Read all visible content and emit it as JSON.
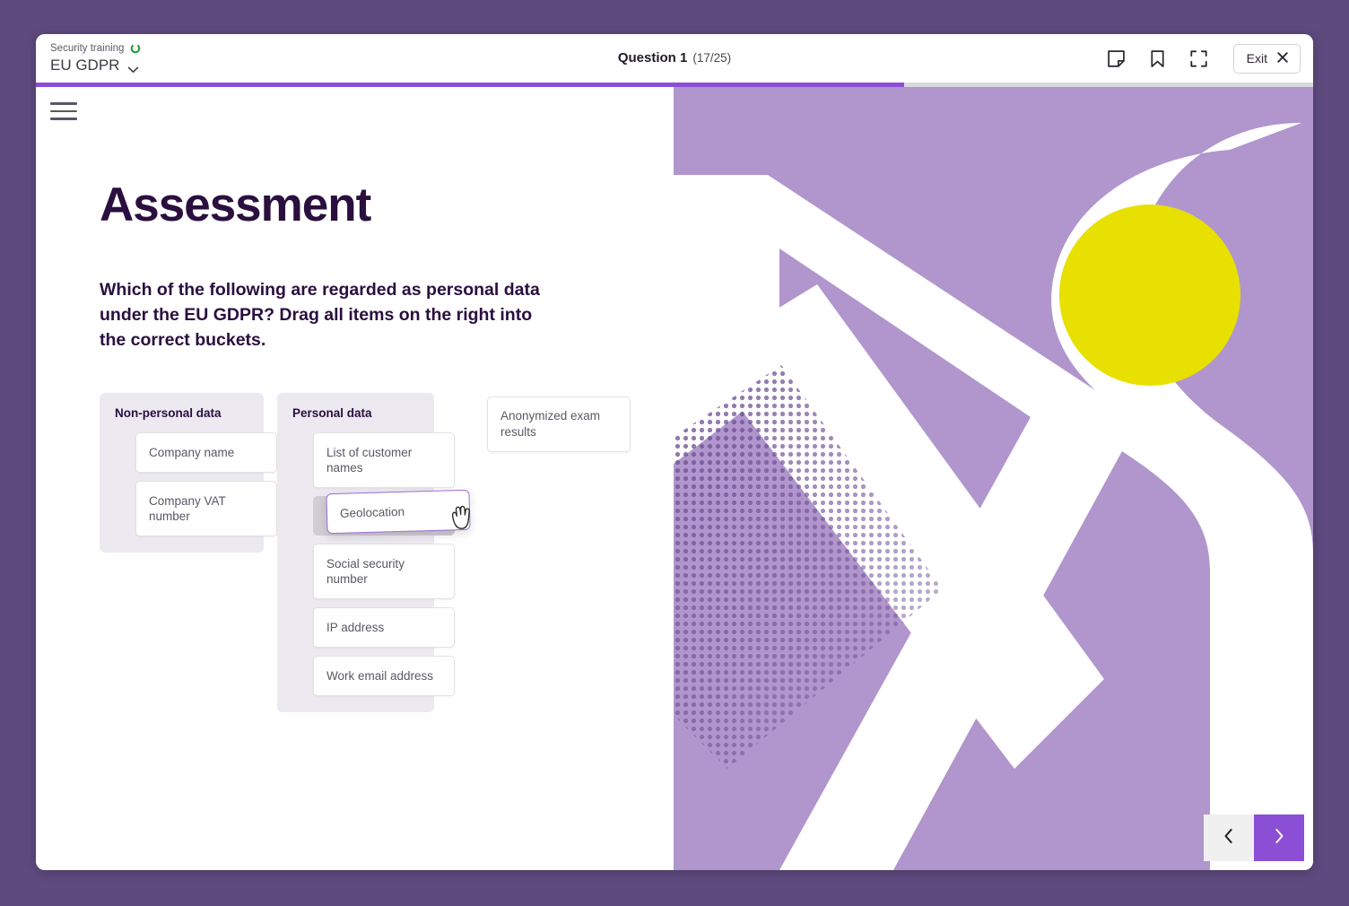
{
  "window": {
    "frame_color": "#5e4a7e",
    "accent_color": "#8b4fd6",
    "lavender": "#b096cc",
    "yellow": "#e8e000"
  },
  "header": {
    "course_label": "Security training",
    "course_name": "EU GDPR",
    "progress_icon": "progress-ring-icon",
    "chevron_icon": "chevron-down-icon",
    "question_title": "Question 1",
    "question_count": "(17/25)",
    "progress_percent": 68,
    "icons": [
      {
        "name": "note-icon",
        "label": "Notes"
      },
      {
        "name": "bookmark-icon",
        "label": "Bookmark"
      },
      {
        "name": "fullscreen-icon",
        "label": "Fullscreen"
      }
    ],
    "exit_label": "Exit",
    "exit_icon": "close-icon"
  },
  "menu": {
    "icon": "hamburger-menu-icon"
  },
  "main": {
    "title": "Assessment",
    "question": "Which of the following are regarded as personal data under the EU GDPR? Drag all items on the right into the correct buckets."
  },
  "buckets": [
    {
      "title": "Non-personal data",
      "items": [
        "Company name",
        "Company VAT number"
      ]
    },
    {
      "title": "Personal data",
      "items": [
        "List of customer names",
        "Social security number",
        "IP address",
        "Work email address"
      ],
      "has_drop_placeholder": true
    }
  ],
  "pool": {
    "items": [
      "Anonymized exam results"
    ]
  },
  "dragging": {
    "label": "Geolocation",
    "cursor": "grabbing-hand-cursor"
  },
  "nav": {
    "prev_icon": "chevron-left-icon",
    "next_icon": "chevron-right-icon"
  }
}
